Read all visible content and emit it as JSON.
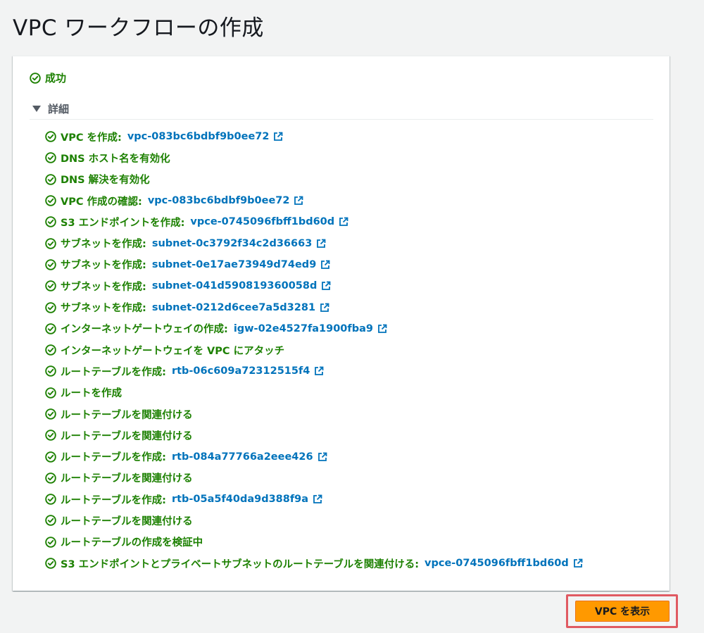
{
  "page": {
    "title": "VPC ワークフローの作成"
  },
  "status": {
    "label": "成功",
    "color": "#1d8102"
  },
  "details": {
    "label": "詳細"
  },
  "steps": [
    {
      "text": "VPC を作成:",
      "link": "vpc-083bc6bdbf9b0ee72"
    },
    {
      "text": "DNS ホスト名を有効化",
      "link": ""
    },
    {
      "text": "DNS 解決を有効化",
      "link": ""
    },
    {
      "text": "VPC 作成の確認:",
      "link": "vpc-083bc6bdbf9b0ee72"
    },
    {
      "text": "S3 エンドポイントを作成:",
      "link": "vpce-0745096fbff1bd60d"
    },
    {
      "text": "サブネットを作成:",
      "link": "subnet-0c3792f34c2d36663"
    },
    {
      "text": "サブネットを作成:",
      "link": "subnet-0e17ae73949d74ed9"
    },
    {
      "text": "サブネットを作成:",
      "link": "subnet-041d590819360058d"
    },
    {
      "text": "サブネットを作成:",
      "link": "subnet-0212d6cee7a5d3281"
    },
    {
      "text": "インターネットゲートウェイの作成:",
      "link": "igw-02e4527fa1900fba9"
    },
    {
      "text": "インターネットゲートウェイを VPC にアタッチ",
      "link": ""
    },
    {
      "text": "ルートテーブルを作成:",
      "link": "rtb-06c609a72312515f4"
    },
    {
      "text": "ルートを作成",
      "link": ""
    },
    {
      "text": "ルートテーブルを関連付ける",
      "link": ""
    },
    {
      "text": "ルートテーブルを関連付ける",
      "link": ""
    },
    {
      "text": "ルートテーブルを作成:",
      "link": "rtb-084a77766a2eee426"
    },
    {
      "text": "ルートテーブルを関連付ける",
      "link": ""
    },
    {
      "text": "ルートテーブルを作成:",
      "link": "rtb-05a5f40da9d388f9a"
    },
    {
      "text": "ルートテーブルを関連付ける",
      "link": ""
    },
    {
      "text": "ルートテーブルの作成を検証中",
      "link": ""
    },
    {
      "text": "S3 エンドポイントとプライベートサブネットのルートテーブルを関連付ける:",
      "link": "vpce-0745096fbff1bd60d"
    }
  ],
  "icons": {
    "step": "check-circle-icon",
    "link": "external-link-icon",
    "details": "caret-down-icon"
  },
  "actions": {
    "view_vpc_label": "VPC を表示",
    "button_color": "#ff9900",
    "highlight_color": "#e05a62"
  }
}
